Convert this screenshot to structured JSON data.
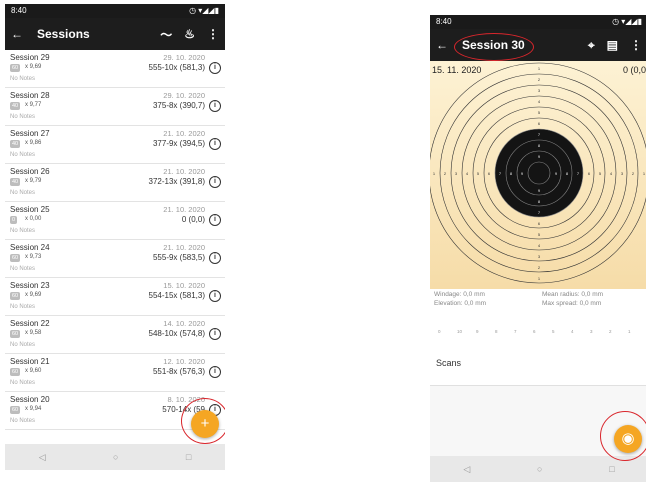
{
  "left": {
    "status": {
      "time": "8:40",
      "icons": "◷ ▾◢◢▮"
    },
    "appbar": {
      "back": "←",
      "title": "Sessions",
      "icon_chart": "〜",
      "icon_fire": "♨",
      "icon_more": "⋮"
    },
    "notes_default": "No Notes",
    "sessions": [
      {
        "name": "Session 29",
        "date": "29. 10. 2020",
        "score": "555-10x (581,3)",
        "badge": "60",
        "avg": "x 9,69"
      },
      {
        "name": "Session 28",
        "date": "29. 10. 2020",
        "score": "375-8x (390,7)",
        "badge": "40",
        "avg": "x 9,77"
      },
      {
        "name": "Session 27",
        "date": "21. 10. 2020",
        "score": "377-9x (394,5)",
        "badge": "40",
        "avg": "x 9,86"
      },
      {
        "name": "Session 26",
        "date": "21. 10. 2020",
        "score": "372-13x (391,8)",
        "badge": "40",
        "avg": "x 9,79"
      },
      {
        "name": "Session 25",
        "date": "21. 10. 2020",
        "score": "0 (0,0)",
        "badge": "0",
        "avg": "x 0,00"
      },
      {
        "name": "Session 24",
        "date": "21. 10. 2020",
        "score": "555-9x (583,5)",
        "badge": "60",
        "avg": "x 9,73"
      },
      {
        "name": "Session 23",
        "date": "15. 10. 2020",
        "score": "554-15x (581,3)",
        "badge": "60",
        "avg": "x 9,69"
      },
      {
        "name": "Session 22",
        "date": "14. 10. 2020",
        "score": "548-10x (574,8)",
        "badge": "60",
        "avg": "x 9,58"
      },
      {
        "name": "Session 21",
        "date": "12. 10. 2020",
        "score": "551-8x (576,3)",
        "badge": "60",
        "avg": "x 9,60"
      },
      {
        "name": "Session 20",
        "date": "8. 10. 2020",
        "score": "570-14x (59",
        "badge": "60",
        "avg": "x 9,94"
      }
    ],
    "fab": "+",
    "nav": {
      "back": "◁",
      "home": "○",
      "recent": "□"
    }
  },
  "right": {
    "status": {
      "time": "8:40",
      "icons": "◷ ▾◢◢▮"
    },
    "appbar": {
      "back": "←",
      "title": "Session 30",
      "icon_target": "⌖",
      "icon_doc": "▤",
      "icon_more": "⋮"
    },
    "date": "15. 11. 2020",
    "score": "0 (0,0",
    "ring_labels": [
      "1",
      "2",
      "3",
      "4",
      "5",
      "6",
      "7",
      "8",
      "9"
    ],
    "stats": {
      "windage": "Windage: 0,0 mm",
      "elevation": "Elevation: 0,0 mm",
      "mean_radius": "Mean radius: 0,0 mm",
      "max_spread": "Max spread: 0,0 mm"
    },
    "ruler_labels": [
      "0",
      "10",
      "9",
      "8",
      "7",
      "6",
      "5",
      "4",
      "3",
      "2",
      "1"
    ],
    "scans_label": "Scans",
    "fab": "◉",
    "nav": {
      "back": "◁",
      "home": "○",
      "recent": "□"
    }
  }
}
